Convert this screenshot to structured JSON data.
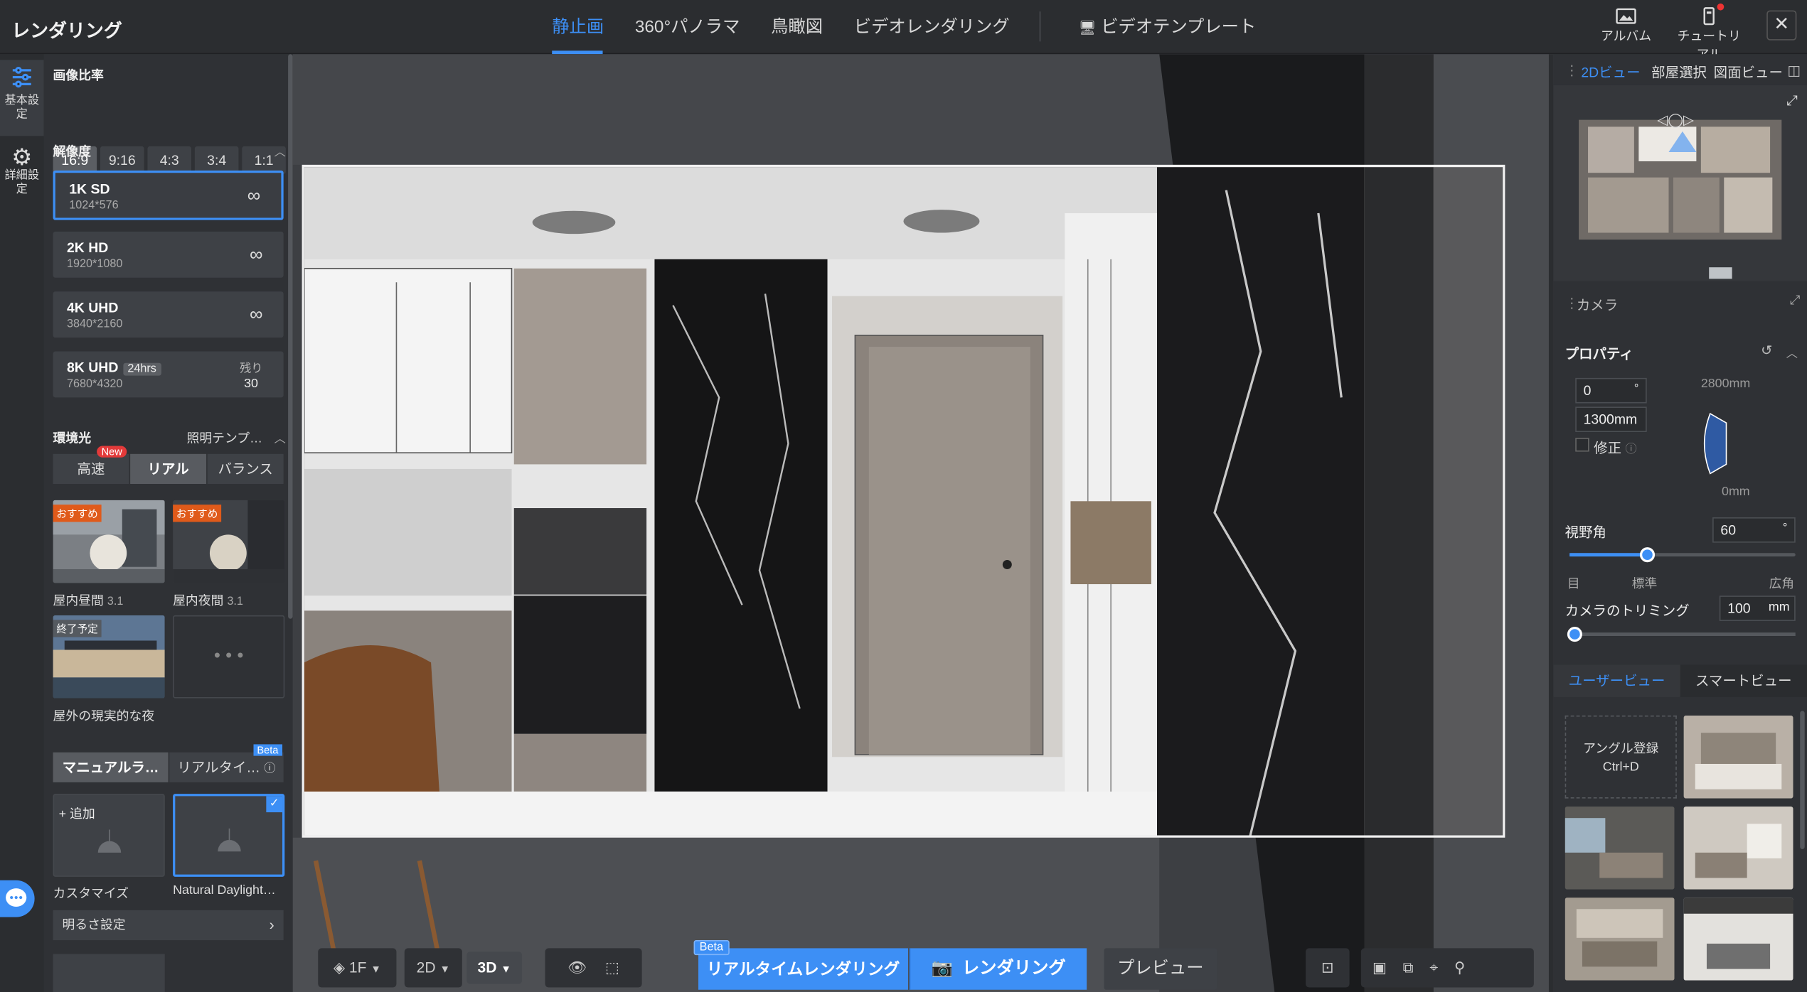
{
  "app": {
    "title": "レンダリング"
  },
  "tabs": [
    "静止画",
    "360°パノラマ",
    "鳥瞰図",
    "ビデオレンダリング"
  ],
  "video_template": "ビデオテンプレート",
  "top_right": {
    "album": "アルバム",
    "tutorial": "チュートリアル"
  },
  "rail": {
    "basic": "基本設定",
    "advanced": "詳細設定"
  },
  "image_ratio": {
    "label": "画像比率",
    "options": [
      "16:9",
      "9:16",
      "4:3",
      "3:4",
      "1:1"
    ],
    "selected": "16:9"
  },
  "resolution": {
    "label": "解像度",
    "items": [
      {
        "name": "1K SD",
        "dims": "1024*576",
        "right": "∞"
      },
      {
        "name": "2K HD",
        "dims": "1920*1080",
        "right": "∞"
      },
      {
        "name": "4K UHD",
        "dims": "3840*2160",
        "right": "∞"
      },
      {
        "name": "8K UHD",
        "badge": "24hrs",
        "dims": "7680*4320",
        "remaining_label": "残り",
        "remaining": "30"
      }
    ]
  },
  "ambient": {
    "label": "環境光",
    "template_link": "照明テンプ…",
    "modes": [
      "高速",
      "リアル",
      "バランス"
    ],
    "new_badge": "New",
    "presets": [
      {
        "name": "屋内昼間",
        "version": "3.1",
        "tag": "おすすめ"
      },
      {
        "name": "屋内夜間",
        "version": "3.1",
        "tag": "おすすめ"
      },
      {
        "name": "屋外の現実的な夜",
        "tag": "終了予定"
      }
    ]
  },
  "lighting": {
    "tabs": [
      "マニュアルラ…",
      "リアルタイ…"
    ],
    "beta": "Beta",
    "add": "+ 追加",
    "items": [
      "カスタマイズ",
      "Natural Daylight…"
    ],
    "brightness": "明るさ設定"
  },
  "bottom": {
    "floor": "1F",
    "view2d": "2D",
    "view3d": "3D",
    "beta": "Beta",
    "realtime": "リアルタイムレンダリング",
    "render": "レンダリング",
    "preview": "プレビュー"
  },
  "right": {
    "tabs": [
      "2Dビュー",
      "部屋選択",
      "図面ビュー"
    ],
    "camera_label": "カメラ",
    "properties_label": "プロパティ",
    "angle_value": "0",
    "angle_unit": "°",
    "height_value": "1300mm",
    "fix_label": "修正",
    "height_max": "2800mm",
    "height_min": "0mm",
    "fov_label": "視野角",
    "fov_value": "60",
    "fov_unit": "°",
    "fov_fraction": 0.34,
    "fov_ticks": [
      "目",
      "標準",
      "広角"
    ],
    "trim_label": "カメラのトリミング",
    "trim_value": "100",
    "trim_unit": "mm",
    "view_tabs": [
      "ユーザービュー",
      "スマートビュー"
    ],
    "register_angle": "アングル登録",
    "register_shortcut": "Ctrl+D"
  },
  "colors": {
    "accent": "#3d8ff5",
    "new": "#e33a3a",
    "tag": "#e05a1a"
  }
}
